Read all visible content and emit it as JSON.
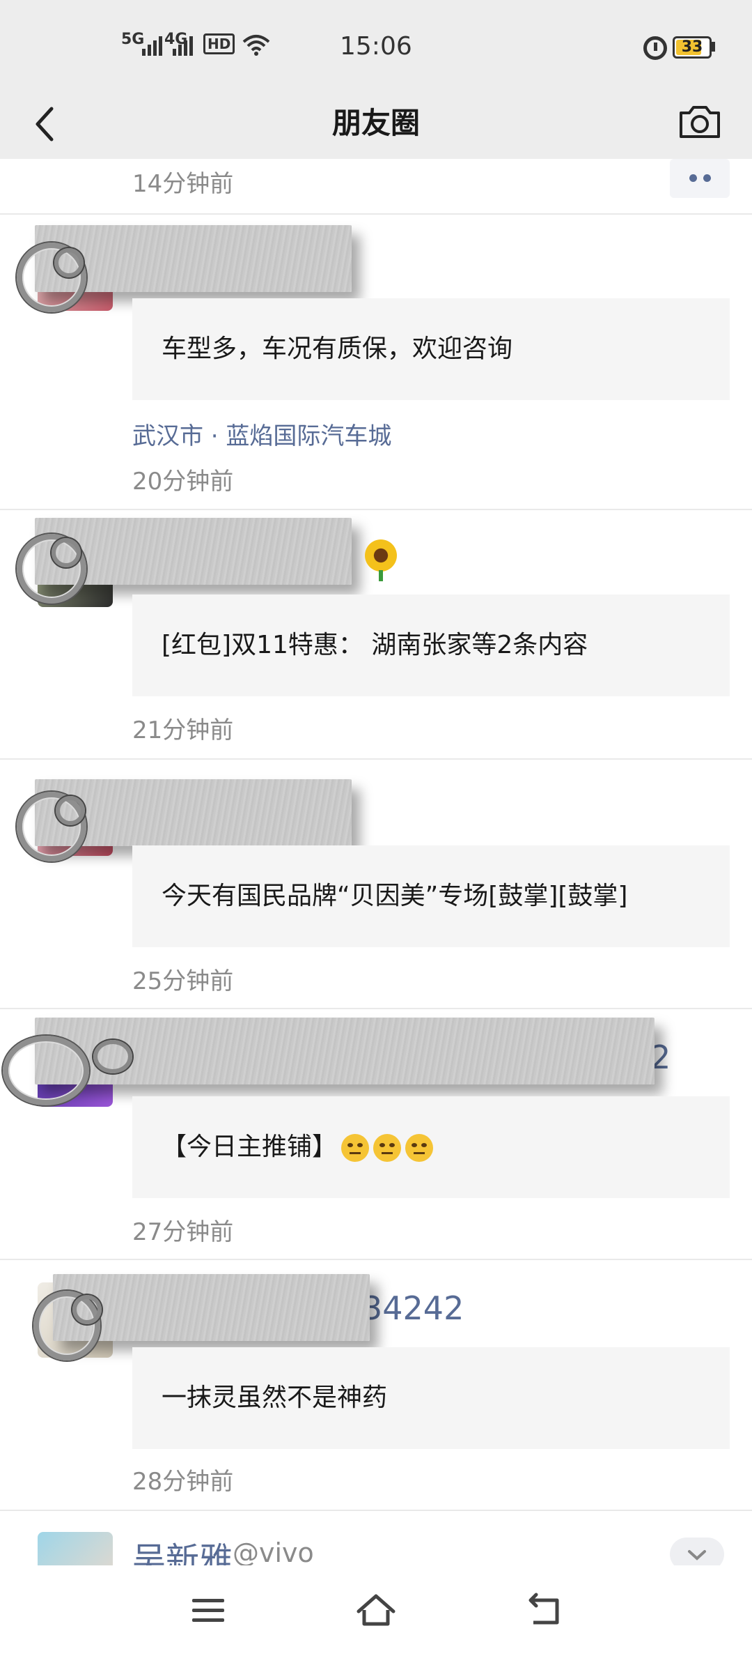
{
  "status_bar": {
    "network_1": "5G",
    "network_2": "4G",
    "hd": "HD",
    "time": "15:06",
    "battery": "33"
  },
  "nav": {
    "title": "朋友圈",
    "back_icon": "chevron-left-icon",
    "camera_icon": "camera-icon"
  },
  "feed": {
    "top_time": "14分钟前",
    "posts": [
      {
        "share_text": "车型多，车况有质保，欢迎咨询",
        "location": "武汉市 · 蓝焰国际汽车城",
        "time": "20分钟前"
      },
      {
        "share_text": "[红包]双11特惠： 湖南张家等2条内容",
        "time": "21分钟前"
      },
      {
        "share_text": "今天有国民品牌“贝因美”专场[鼓掌][鼓掌]",
        "time": "25分钟前"
      },
      {
        "name_tail": "2",
        "share_text": "【今日主推铺】",
        "time": "27分钟前"
      },
      {
        "name_tail": "34242",
        "share_text": "一抹灵虽然不是神药",
        "time": "28分钟前"
      }
    ],
    "last_post": {
      "name": "吴新雅",
      "handle": "@vivo"
    }
  },
  "colors": {
    "header_bg": "#ededed",
    "link_blue": "#576b95",
    "time_gray": "#8a8a8a",
    "share_bg": "#f5f5f5"
  }
}
